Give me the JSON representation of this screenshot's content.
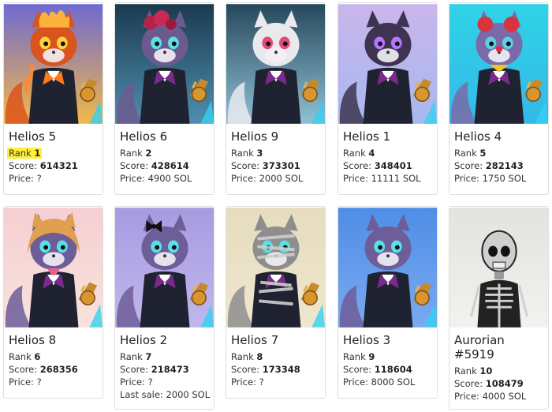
{
  "cards": [
    {
      "name": "Helios 5",
      "rank_label": "Rank",
      "rank": "1",
      "score_label": "Score:",
      "score": "614321",
      "price_label": "Price:",
      "price": "?",
      "bg1": "#6f6ad1",
      "bg2": "#f2b84b",
      "fur": "#d9541e",
      "eye": "#ffd23a",
      "icon": "fire-cat-art"
    },
    {
      "name": "Helios 6",
      "rank_label": "Rank",
      "rank": "2",
      "score_label": "Score:",
      "score": "428614",
      "price_label": "Price:",
      "price": "4900 SOL",
      "bg1": "#1b3a4f",
      "bg2": "#4f8fb0",
      "fur": "#6c5a8f",
      "eye": "#59e0e6",
      "icon": "rose-cat-art"
    },
    {
      "name": "Helios 9",
      "rank_label": "Rank",
      "rank": "3",
      "score_label": "Score:",
      "score": "373301",
      "price_label": "Price:",
      "price": "2000 SOL",
      "bg1": "#27485c",
      "bg2": "#8fc1d6",
      "fur": "#e9e9ee",
      "eye": "#e24b7a",
      "icon": "white-cat-art"
    },
    {
      "name": "Helios 1",
      "rank_label": "Rank",
      "rank": "4",
      "score_label": "Score:",
      "score": "348401",
      "price_label": "Price:",
      "price": "11111 SOL",
      "bg1": "#c9b6ec",
      "bg2": "#a6b8ee",
      "fur": "#3e3451",
      "eye": "#b774ff",
      "icon": "black-cat-art"
    },
    {
      "name": "Helios 4",
      "rank_label": "Rank",
      "rank": "5",
      "score_label": "Score:",
      "score": "282143",
      "price_label": "Price:",
      "price": "1750 SOL",
      "bg1": "#2fd3e7",
      "bg2": "#35b8e8",
      "fur": "#7a6ba8",
      "eye": "#5ad0e2",
      "icon": "clown-cat-art"
    },
    {
      "name": "Helios 8",
      "rank_label": "Rank",
      "rank": "6",
      "score_label": "Score:",
      "score": "268356",
      "price_label": "Price:",
      "price": "?",
      "bg1": "#f5cfd3",
      "bg2": "#f8e2dc",
      "fur": "#6d5d98",
      "eye": "#59e0e6",
      "icon": "shiba-hood-cat-art"
    },
    {
      "name": "Helios 2",
      "rank_label": "Rank",
      "rank": "7",
      "score_label": "Score:",
      "score": "218473",
      "price_label": "Price:",
      "price": "?",
      "extra": "Last sale: 2000 SOL",
      "bg1": "#a79be0",
      "bg2": "#c0b7ee",
      "fur": "#6d5d98",
      "eye": "#59e0e6",
      "icon": "bow-cat-art"
    },
    {
      "name": "Helios 7",
      "rank_label": "Rank",
      "rank": "8",
      "score_label": "Score:",
      "score": "173348",
      "price_label": "Price:",
      "price": "?",
      "bg1": "#e6dcbe",
      "bg2": "#efe6cf",
      "fur": "#8e8e8e",
      "eye": "#59e0e6",
      "icon": "mummy-cat-art"
    },
    {
      "name": "Helios 3",
      "rank_label": "Rank",
      "rank": "9",
      "score_label": "Score:",
      "score": "118604",
      "price_label": "Price:",
      "price": "8000 SOL",
      "bg1": "#4f8de6",
      "bg2": "#7aaaf0",
      "fur": "#6d5d98",
      "eye": "#59e0e6",
      "icon": "blue-cat-art"
    },
    {
      "name": "Aurorian #5919",
      "rank_label": "Rank",
      "rank": "10",
      "score_label": "Score:",
      "score": "108479",
      "price_label": "Price:",
      "price": "4000 SOL",
      "bg1": "#e3e3df",
      "bg2": "#f1f1ee",
      "fur": "#3a3a3a",
      "eye": "#111111",
      "icon": "skeleton-art"
    }
  ],
  "highlight_color": "#ffef3a"
}
